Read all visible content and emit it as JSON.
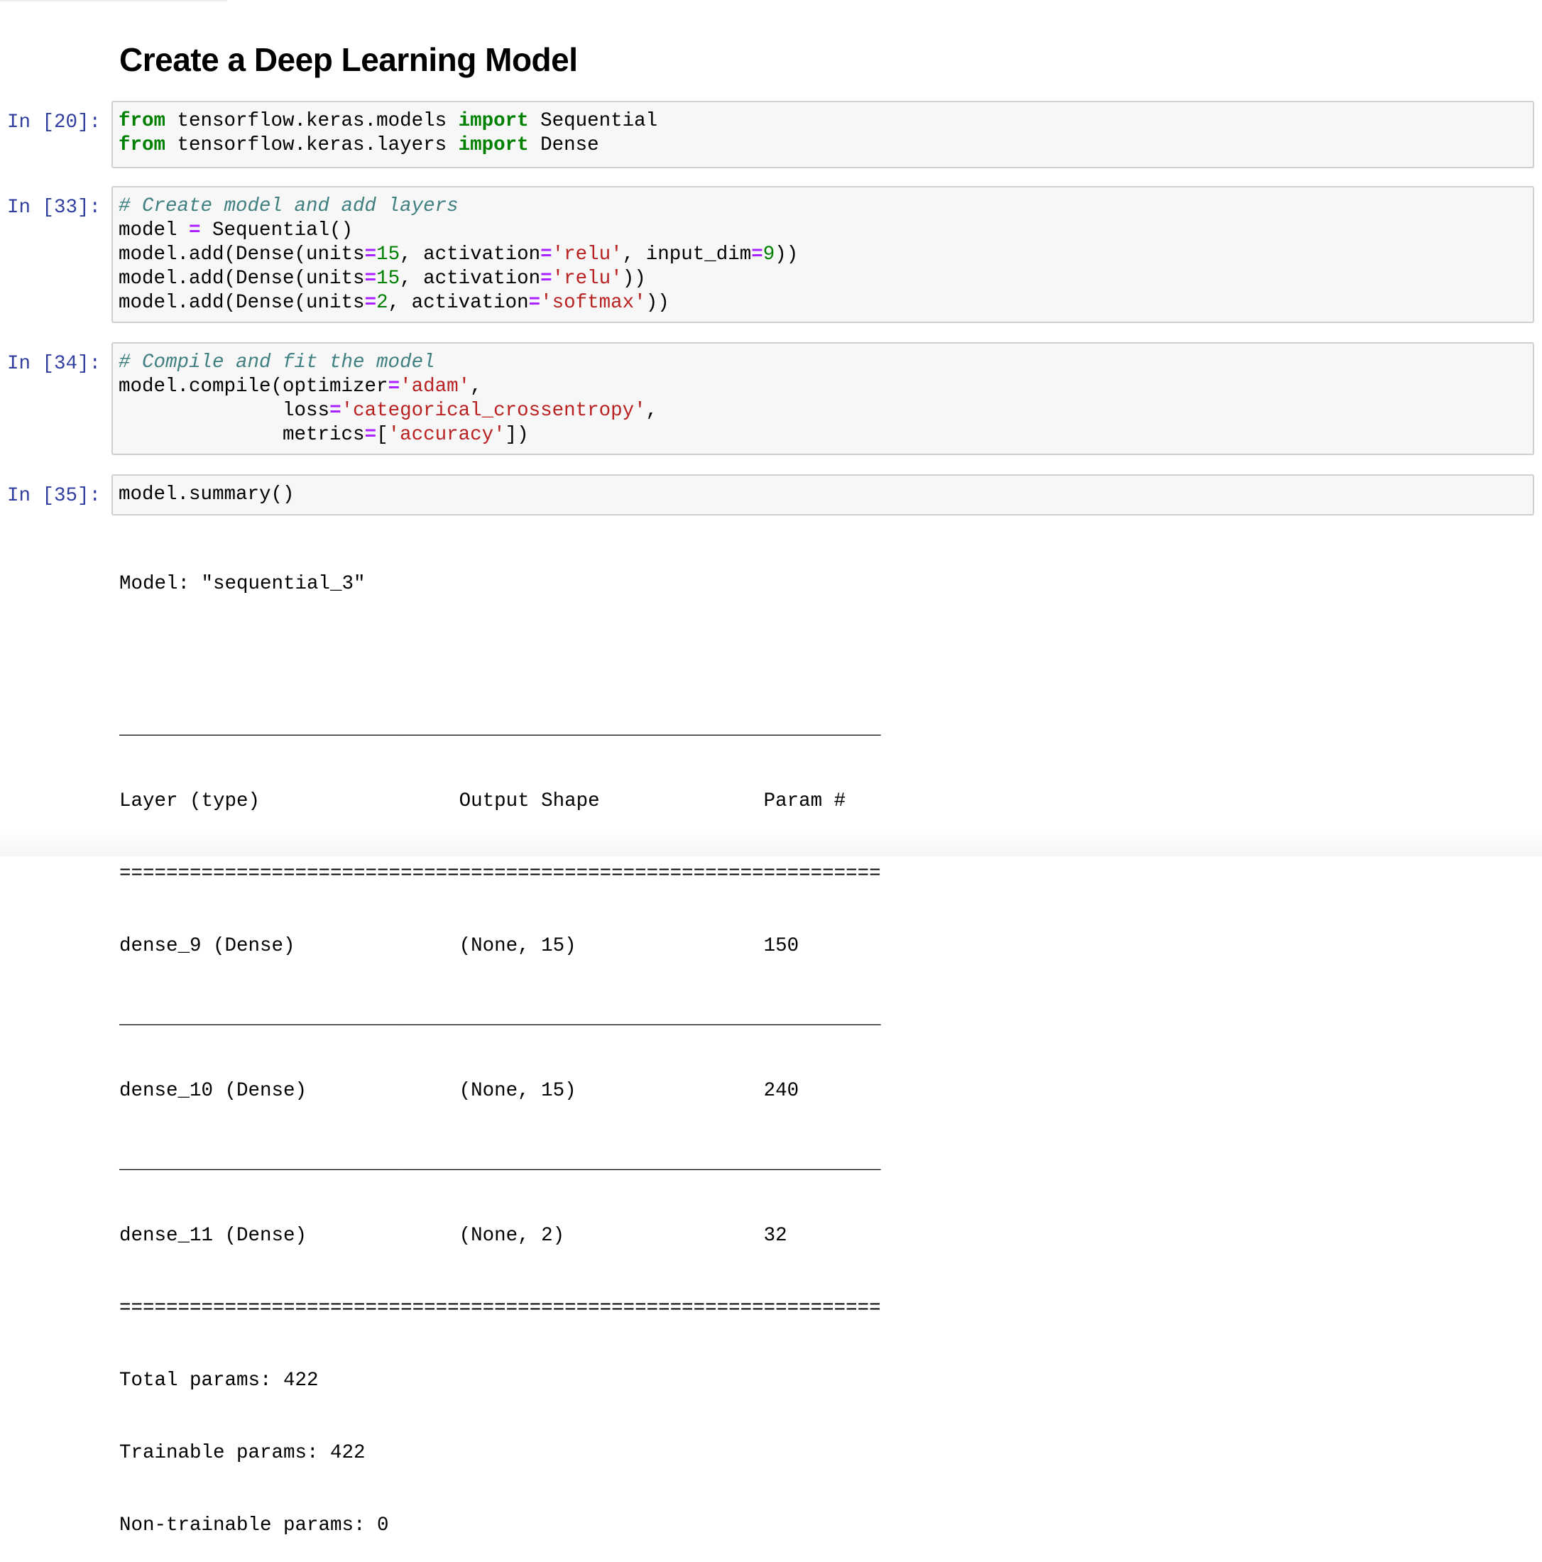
{
  "heading": "Create a Deep Learning Model",
  "cells": [
    {
      "prompt": "In [20]:",
      "lines": [
        [
          [
            "kw",
            "from"
          ],
          [
            "t",
            " tensorflow.keras.models "
          ],
          [
            "kw",
            "import"
          ],
          [
            "t",
            " Sequential"
          ]
        ],
        [
          [
            "kw",
            "from"
          ],
          [
            "t",
            " tensorflow.keras.layers "
          ],
          [
            "kw",
            "import"
          ],
          [
            "t",
            " Dense"
          ]
        ]
      ]
    },
    {
      "prompt": "In [33]:",
      "lines": [
        [
          [
            "cm",
            "# Create model and add layers"
          ]
        ],
        [
          [
            "t",
            "model "
          ],
          [
            "op",
            "="
          ],
          [
            "t",
            " Sequential()"
          ]
        ],
        [
          [
            "t",
            "model.add(Dense(units"
          ],
          [
            "op",
            "="
          ],
          [
            "num",
            "15"
          ],
          [
            "t",
            ", activation"
          ],
          [
            "op",
            "="
          ],
          [
            "str",
            "'relu'"
          ],
          [
            "t",
            ", input_dim"
          ],
          [
            "op",
            "="
          ],
          [
            "num",
            "9"
          ],
          [
            "t",
            "))"
          ]
        ],
        [
          [
            "t",
            "model.add(Dense(units"
          ],
          [
            "op",
            "="
          ],
          [
            "num",
            "15"
          ],
          [
            "t",
            ", activation"
          ],
          [
            "op",
            "="
          ],
          [
            "str",
            "'relu'"
          ],
          [
            "t",
            "))"
          ]
        ],
        [
          [
            "t",
            "model.add(Dense(units"
          ],
          [
            "op",
            "="
          ],
          [
            "num",
            "2"
          ],
          [
            "t",
            ", activation"
          ],
          [
            "op",
            "="
          ],
          [
            "str",
            "'softmax'"
          ],
          [
            "t",
            "))"
          ]
        ]
      ]
    },
    {
      "prompt": "In [34]:",
      "lines": [
        [
          [
            "cm",
            "# Compile and fit the model"
          ]
        ],
        [
          [
            "t",
            "model.compile(optimizer"
          ],
          [
            "op",
            "="
          ],
          [
            "str",
            "'adam'"
          ],
          [
            "t",
            ","
          ]
        ],
        [
          [
            "t",
            "              loss"
          ],
          [
            "op",
            "="
          ],
          [
            "str",
            "'categorical_crossentropy'"
          ],
          [
            "t",
            ","
          ]
        ],
        [
          [
            "t",
            "              metrics"
          ],
          [
            "op",
            "="
          ],
          [
            "t",
            "["
          ],
          [
            "str",
            "'accuracy'"
          ],
          [
            "t",
            "])"
          ]
        ]
      ]
    },
    {
      "prompt": "In [35]:",
      "lines": [
        [
          [
            "t",
            "model.summary()"
          ]
        ]
      ]
    }
  ],
  "output": {
    "model_title": "Model: \"sequential_3\"",
    "rule_line": "_________________________________________________________________",
    "double_rule": "=================================================================",
    "header": "Layer (type)                 Output Shape              Param #",
    "rows": [
      "dense_9 (Dense)              (None, 15)                150",
      "dense_10 (Dense)             (None, 15)                240",
      "dense_11 (Dense)             (None, 2)                 32"
    ],
    "total": "Total params: 422",
    "trainable": "Trainable params: 422",
    "non_trainable": "Non-trainable params: 0"
  }
}
